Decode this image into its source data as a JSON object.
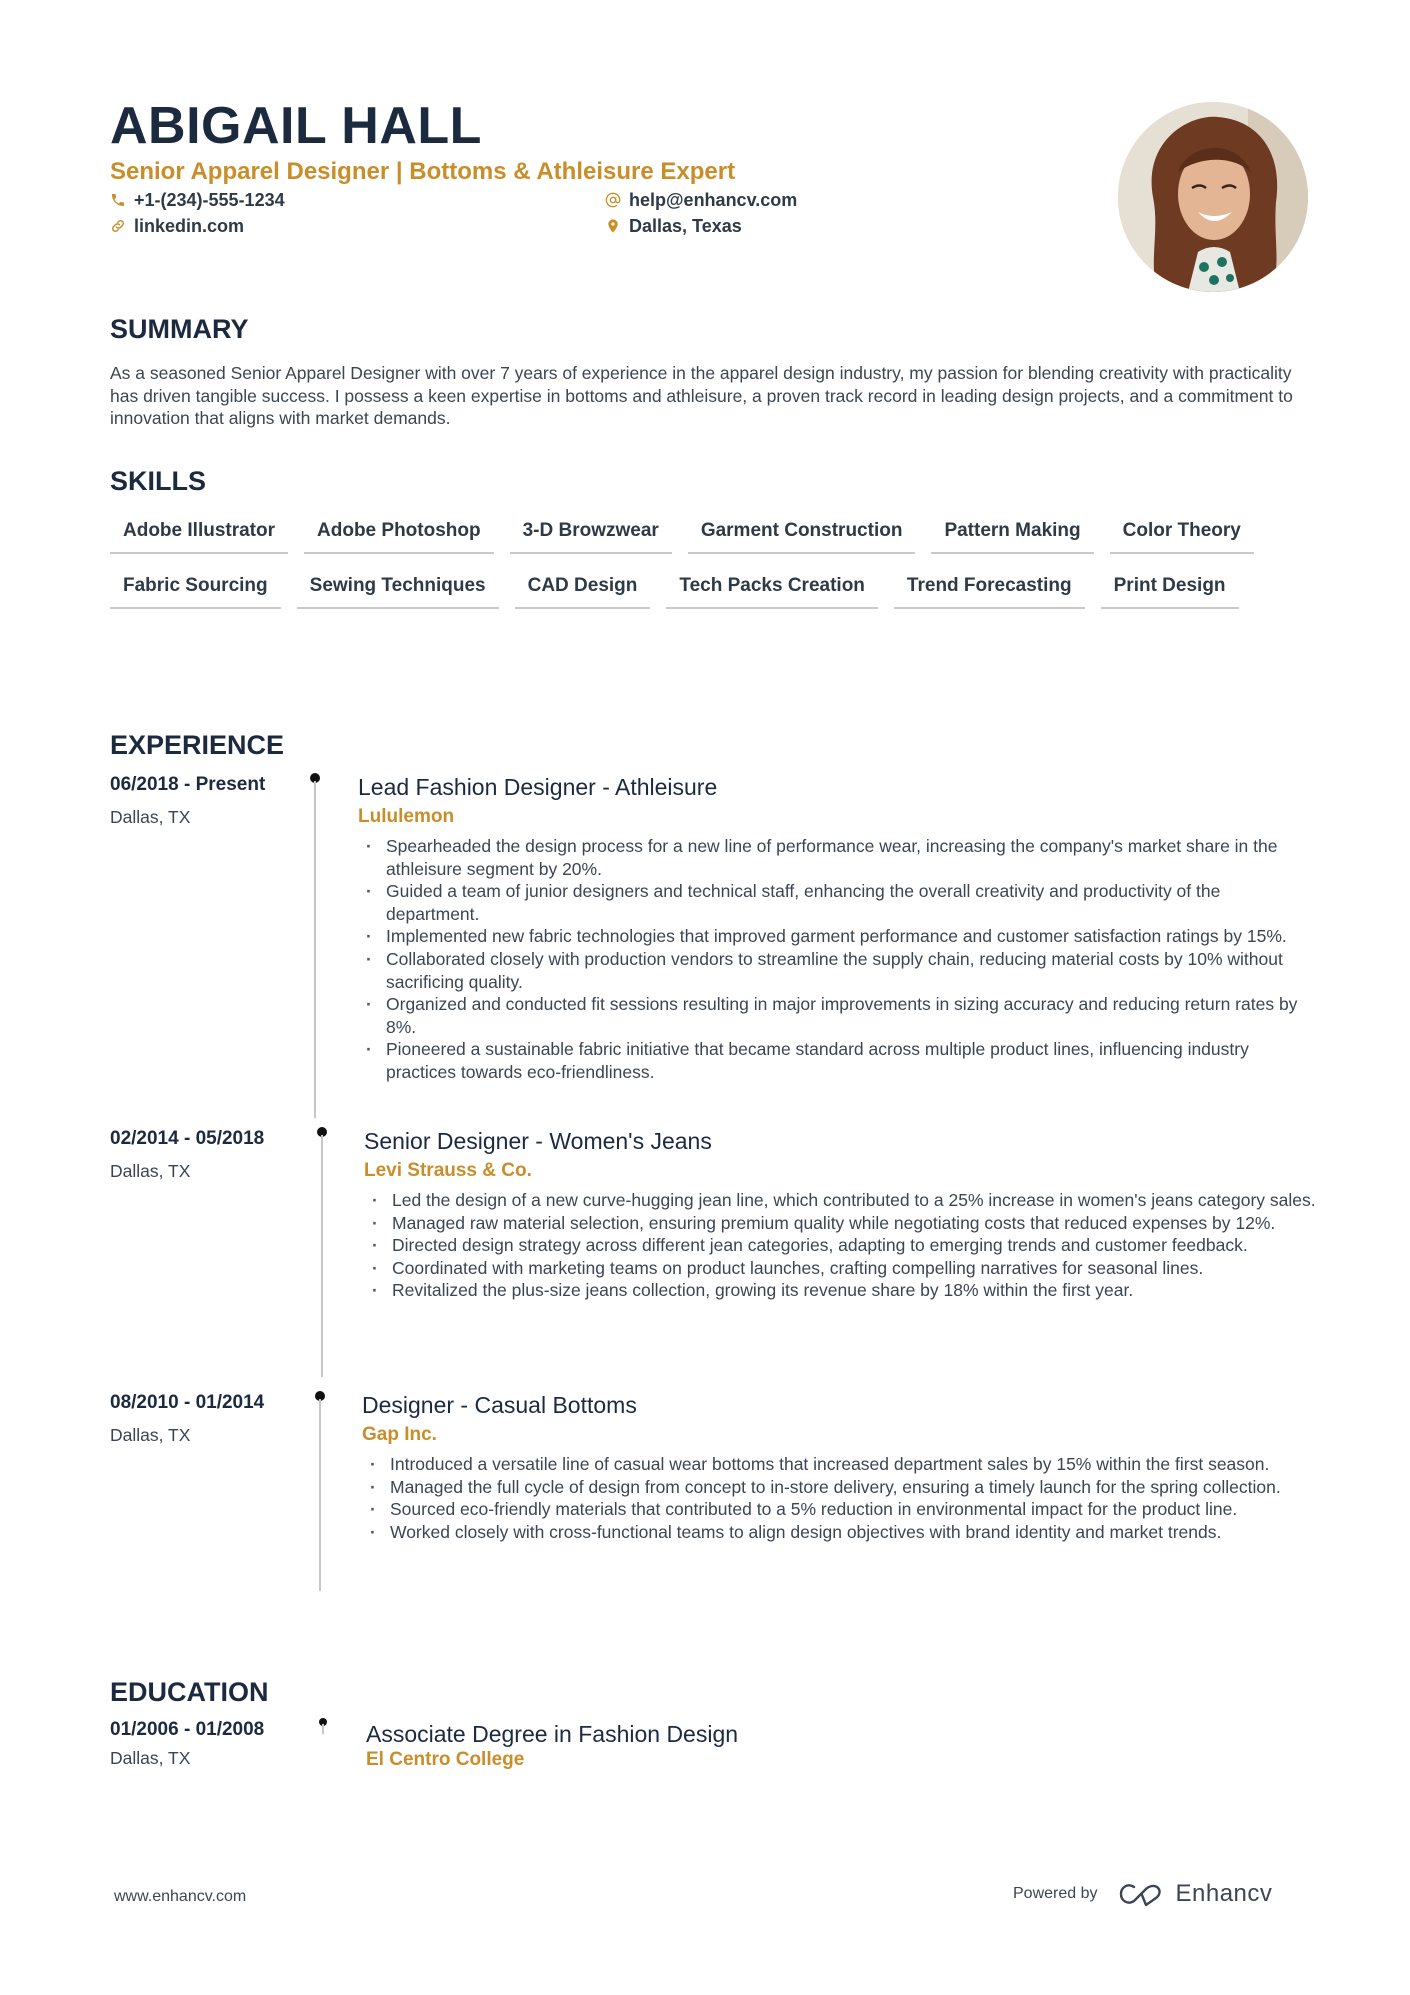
{
  "header": {
    "name": "ABIGAIL HALL",
    "headline": "Senior Apparel Designer | Bottoms & Athleisure Expert",
    "contacts": {
      "phone": {
        "icon": "phone-icon",
        "text": "+1-(234)-555-1234"
      },
      "email": {
        "icon": "at-icon",
        "text": "help@enhancv.com"
      },
      "linkedin": {
        "icon": "link-icon",
        "text": "linkedin.com"
      },
      "location": {
        "icon": "location-pin-icon",
        "text": "Dallas, Texas"
      }
    },
    "photo_alt": "profile-photo"
  },
  "colors": {
    "accent": "#c98e2a",
    "heading": "#1c2a40",
    "body": "#3c4652",
    "timeline_line": "#c6c6c6",
    "timeline_dot": "#111111"
  },
  "summary": {
    "title": "SUMMARY",
    "text": "As a seasoned Senior Apparel Designer with over 7 years of experience in the apparel design industry, my passion for blending creativity with practicality has driven tangible success. I possess a keen expertise in bottoms and athleisure, a proven track record in leading design projects, and a commitment to innovation that aligns with market demands."
  },
  "skills": {
    "title": "SKILLS",
    "items": [
      "Adobe Illustrator",
      "Adobe Photoshop",
      "3-D Browzwear",
      "Garment Construction",
      "Pattern Making",
      "Color Theory",
      "Fabric Sourcing",
      "Sewing Techniques",
      "CAD Design",
      "Tech Packs Creation",
      "Trend Forecasting",
      "Print Design"
    ]
  },
  "experience": {
    "title": "EXPERIENCE",
    "items": [
      {
        "dates": "06/2018 - Present",
        "location": "Dallas, TX",
        "title": "Lead Fashion Designer - Athleisure",
        "company": "Lululemon",
        "bullets": [
          "Spearheaded the design process for a new line of performance wear, increasing the company's market share in the athleisure segment by 20%.",
          "Guided a team of junior designers and technical staff, enhancing the overall creativity and productivity of the department.",
          "Implemented new fabric technologies that improved garment performance and customer satisfaction ratings by 15%.",
          "Collaborated closely with production vendors to streamline the supply chain, reducing material costs by 10% without sacrificing quality.",
          "Organized and conducted fit sessions resulting in major improvements in sizing accuracy and reducing return rates by 8%.",
          "Pioneered a sustainable fabric initiative that became standard across multiple product lines, influencing industry practices towards eco-friendliness."
        ]
      },
      {
        "dates": "02/2014 - 05/2018",
        "location": "Dallas, TX",
        "title": "Senior Designer - Women's Jeans",
        "company": "Levi Strauss & Co.",
        "bullets": [
          "Led the design of a new curve-hugging jean line, which contributed to a 25% increase in women's jeans category sales.",
          "Managed raw material selection, ensuring premium quality while negotiating costs that reduced expenses by 12%.",
          "Directed design strategy across different jean categories, adapting to emerging trends and customer feedback.",
          "Coordinated with marketing teams on product launches, crafting compelling narratives for seasonal lines.",
          "Revitalized the plus-size jeans collection, growing its revenue share by 18% within the first year."
        ]
      },
      {
        "dates": "08/2010 - 01/2014",
        "location": "Dallas, TX",
        "title": "Designer - Casual Bottoms",
        "company": "Gap Inc.",
        "bullets": [
          "Introduced a versatile line of casual wear bottoms that increased department sales by 15% within the first season.",
          "Managed the full cycle of design from concept to in-store delivery, ensuring a timely launch for the spring collection.",
          "Sourced eco-friendly materials that contributed to a 5% reduction in environmental impact for the product line.",
          "Worked closely with cross-functional teams to align design objectives with brand identity and market trends."
        ]
      }
    ]
  },
  "education": {
    "title": "EDUCATION",
    "items": [
      {
        "dates": "01/2006 - 01/2008",
        "location": "Dallas, TX",
        "degree": "Associate Degree in Fashion Design",
        "school": "El Centro College"
      }
    ]
  },
  "footer": {
    "website": "www.enhancv.com",
    "powered_by": "Powered by",
    "brand": "Enhancv"
  }
}
